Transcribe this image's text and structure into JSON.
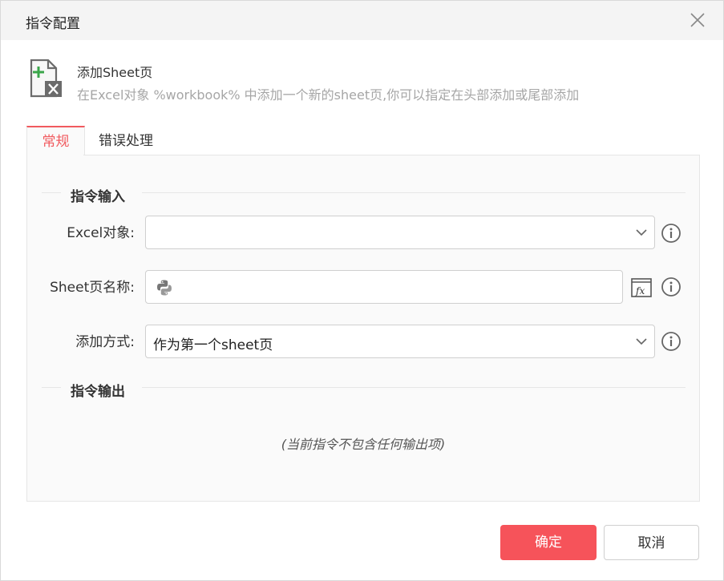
{
  "dialog": {
    "title": "指令配置"
  },
  "command": {
    "name": "添加Sheet页",
    "description": "在Excel对象 %workbook% 中添加一个新的sheet页,你可以指定在头部添加或尾部添加",
    "icon": "excel-add-sheet-icon"
  },
  "tabs": [
    {
      "label": "常规",
      "active": true
    },
    {
      "label": "错误处理",
      "active": false
    }
  ],
  "input_section": {
    "title": "指令输入",
    "fields": [
      {
        "label": "Excel对象:",
        "value": "",
        "type": "select"
      },
      {
        "label": "Sheet页名称:",
        "value": "",
        "type": "text-python"
      },
      {
        "label": "添加方式:",
        "value": "作为第一个sheet页",
        "type": "select"
      }
    ]
  },
  "output_section": {
    "title": "指令输出",
    "empty_text": "(当前指令不包含任何输出项)"
  },
  "buttons": {
    "ok": "确定",
    "cancel": "取消"
  },
  "colors": {
    "accent": "#f15a5e",
    "ok_button": "#f6535a",
    "excel_green": "#3aa64a"
  }
}
